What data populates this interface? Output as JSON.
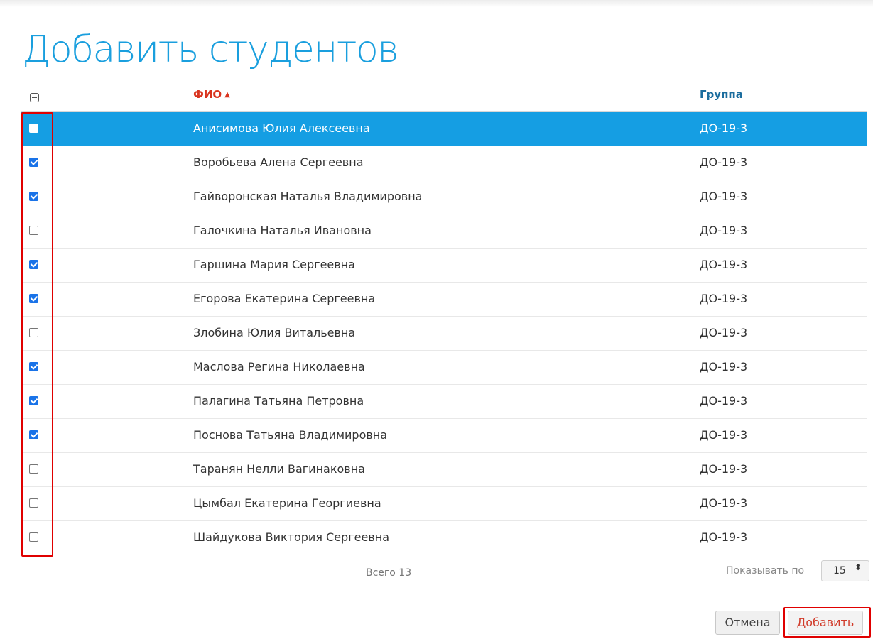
{
  "page": {
    "title": "Добавить студентов"
  },
  "table": {
    "columns": {
      "fio": "ФИО",
      "group": "Группа"
    },
    "sort_indicator": "▲",
    "rows": [
      {
        "fio": "Анисимова Юлия Алексеевна",
        "group": "ДО-19-3",
        "checked": false,
        "selected": true
      },
      {
        "fio": "Воробьева Алена Сергеевна",
        "group": "ДО-19-3",
        "checked": true,
        "selected": false
      },
      {
        "fio": "Гайворонская Наталья Владимировна",
        "group": "ДО-19-3",
        "checked": true,
        "selected": false
      },
      {
        "fio": "Галочкина Наталья Ивановна",
        "group": "ДО-19-3",
        "checked": false,
        "selected": false
      },
      {
        "fio": "Гаршина Мария Сергеевна",
        "group": "ДО-19-3",
        "checked": true,
        "selected": false
      },
      {
        "fio": "Егорова Екатерина Сергеевна",
        "group": "ДО-19-3",
        "checked": true,
        "selected": false
      },
      {
        "fio": "Злобина Юлия Витальевна",
        "group": "ДО-19-3",
        "checked": false,
        "selected": false
      },
      {
        "fio": "Маслова Регина Николаевна",
        "group": "ДО-19-3",
        "checked": true,
        "selected": false
      },
      {
        "fio": "Палагина Татьяна Петровна",
        "group": "ДО-19-3",
        "checked": true,
        "selected": false
      },
      {
        "fio": "Поснова Татьяна Владимировна",
        "group": "ДО-19-3",
        "checked": true,
        "selected": false
      },
      {
        "fio": "Таранян Нелли Вагинаковна",
        "group": "ДО-19-3",
        "checked": false,
        "selected": false
      },
      {
        "fio": "Цымбал Екатерина Георгиевна",
        "group": "ДО-19-3",
        "checked": false,
        "selected": false
      },
      {
        "fio": "Шайдукова Виктория Сергеевна",
        "group": "ДО-19-3",
        "checked": false,
        "selected": false
      }
    ]
  },
  "footer": {
    "total_label": "Всего 13",
    "page_size_label": "Показывать по",
    "page_size_value": "15",
    "page_size_arrows": "⬍"
  },
  "actions": {
    "cancel_label": "Отмена",
    "add_label": "Добавить"
  },
  "colors": {
    "title": "#1a9fde",
    "selected_row": "#159ee3",
    "sorted_header": "#d9341e",
    "header": "#1b6d9e",
    "checkbox_checked": "#1a73e8",
    "highlight_box": "#e00000",
    "add_button_text": "#d13b2a"
  }
}
